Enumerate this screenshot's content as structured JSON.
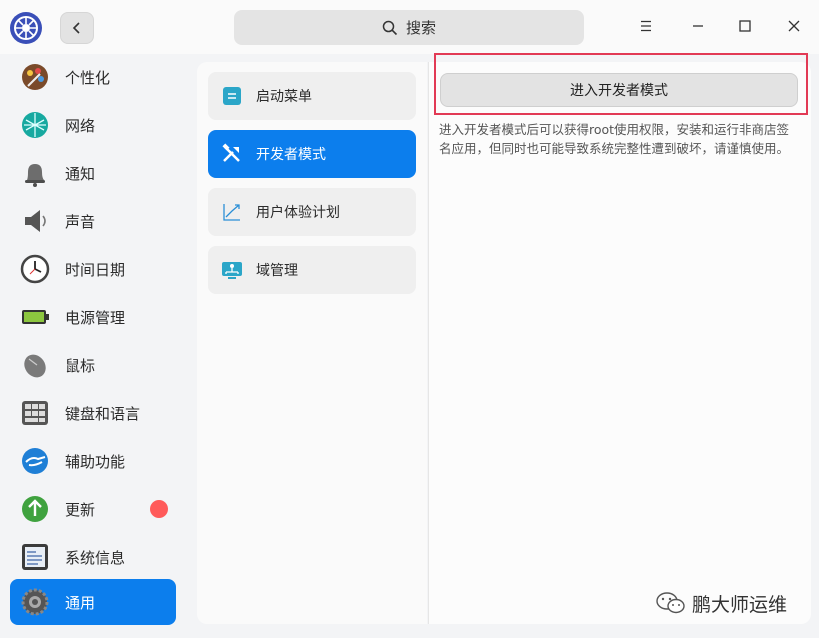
{
  "header": {
    "search_label": "搜索"
  },
  "sidebar": {
    "items": [
      {
        "label": "个性化",
        "icon": "palette-icon"
      },
      {
        "label": "网络",
        "icon": "network-icon"
      },
      {
        "label": "通知",
        "icon": "bell-icon"
      },
      {
        "label": "声音",
        "icon": "speaker-icon"
      },
      {
        "label": "时间日期",
        "icon": "clock-icon"
      },
      {
        "label": "电源管理",
        "icon": "battery-icon"
      },
      {
        "label": "鼠标",
        "icon": "mouse-icon"
      },
      {
        "label": "键盘和语言",
        "icon": "keyboard-icon"
      },
      {
        "label": "辅助功能",
        "icon": "accessibility-icon"
      },
      {
        "label": "更新",
        "icon": "update-arrow-icon"
      },
      {
        "label": "系统信息",
        "icon": "system-info-icon"
      },
      {
        "label": "通用",
        "icon": "gear-icon"
      }
    ],
    "active_index": 11
  },
  "sub_menu": {
    "items": [
      {
        "label": "启动菜单",
        "icon": "boot-menu-icon"
      },
      {
        "label": "开发者模式",
        "icon": "tools-icon"
      },
      {
        "label": "用户体验计划",
        "icon": "chart-trend-icon"
      },
      {
        "label": "域管理",
        "icon": "domain-icon"
      }
    ],
    "active_index": 1
  },
  "content": {
    "button_label": "进入开发者模式",
    "description": "进入开发者模式后可以获得root使用权限，安装和运行非商店签名应用，但同时也可能导致系统完整性遭到破坏，请谨慎使用。"
  },
  "watermark": {
    "text": "鹏大师运维"
  },
  "colors": {
    "accent": "#0c7eed",
    "highlight_frame": "#e23a55",
    "update_badge": "#ff5a5a"
  }
}
